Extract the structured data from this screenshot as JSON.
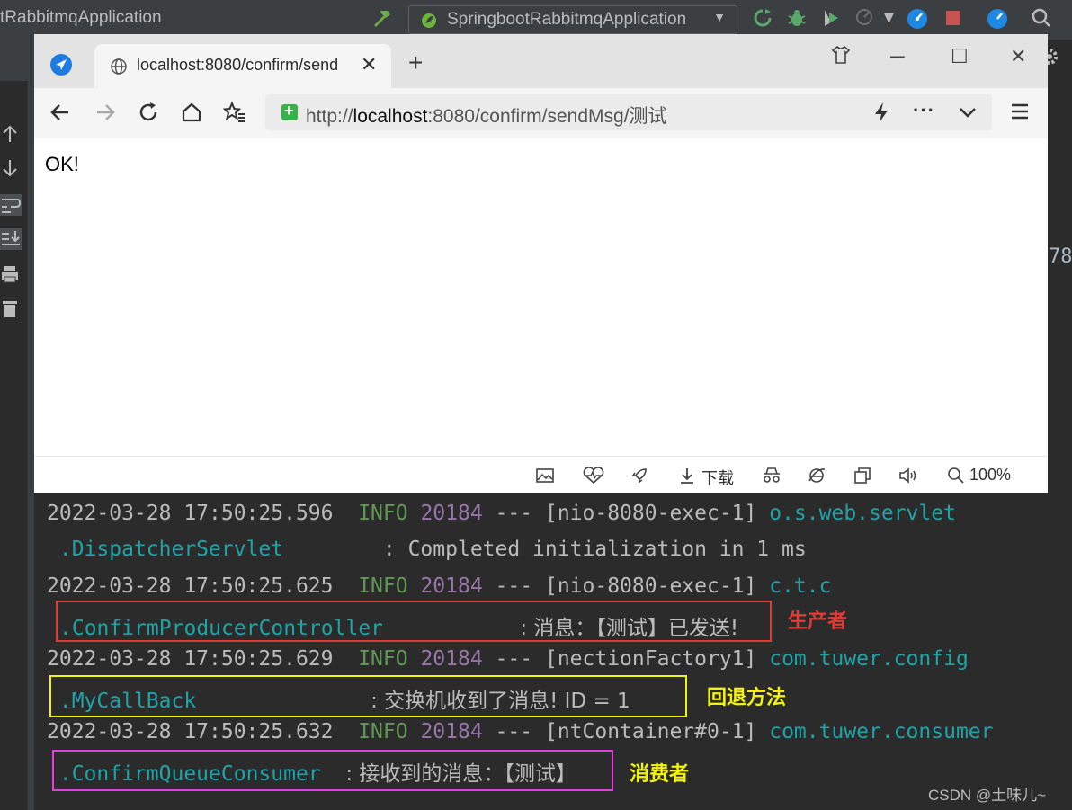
{
  "ide": {
    "title": "tRabbitmqApplication",
    "run_config": "SpringbootRabbitmqApplication",
    "right_edge_text": "78"
  },
  "browser": {
    "tab_title": "localhost:8080/confirm/send",
    "url_prefix": "http://",
    "url_host": "localhost",
    "url_rest": ":8080/confirm/sendMsg/测试",
    "page_text": "OK!",
    "status_download": "下载",
    "zoom": "100%"
  },
  "console": {
    "lines": [
      {
        "ts": "2022-03-28 17:50:25.596",
        "level": "INFO",
        "pid": "20184",
        "sep": "---",
        "thread": "[nio-8080-exec-1]",
        "logger": "o.s.web.servlet"
      },
      {
        "logger_cont": ".DispatcherServlet",
        "message": ": Completed initialization in 1 ms"
      },
      {
        "ts": "2022-03-28 17:50:25.625",
        "level": "INFO",
        "pid": "20184",
        "sep": "---",
        "thread": "[nio-8080-exec-1]",
        "logger": "c.t.c"
      },
      {
        "logger_cont": ".ConfirmProducerController",
        "message": ": 消息：【测试】已发送!"
      },
      {
        "ts": "2022-03-28 17:50:25.629",
        "level": "INFO",
        "pid": "20184",
        "sep": "---",
        "thread": "[nectionFactory1]",
        "logger": "com.tuwer.config"
      },
      {
        "logger_cont": ".MyCallBack",
        "message": ": 交换机收到了消息! ID = 1"
      },
      {
        "ts": "2022-03-28 17:50:25.632",
        "level": "INFO",
        "pid": "20184",
        "sep": "---",
        "thread": "[ntContainer#0-1]",
        "logger": "com.tuwer.consumer"
      },
      {
        "logger_cont": ".ConfirmQueueConsumer",
        "message": ": 接收到的消息：【测试】"
      }
    ]
  },
  "annotations": {
    "producer": "生产者",
    "callback": "回退方法",
    "consumer": "消费者"
  },
  "colors": {
    "producer_box": "#e53935",
    "callback_box": "#f2f20a",
    "consumer_box": "#e040e0"
  },
  "watermark": "CSDN @土味儿~"
}
